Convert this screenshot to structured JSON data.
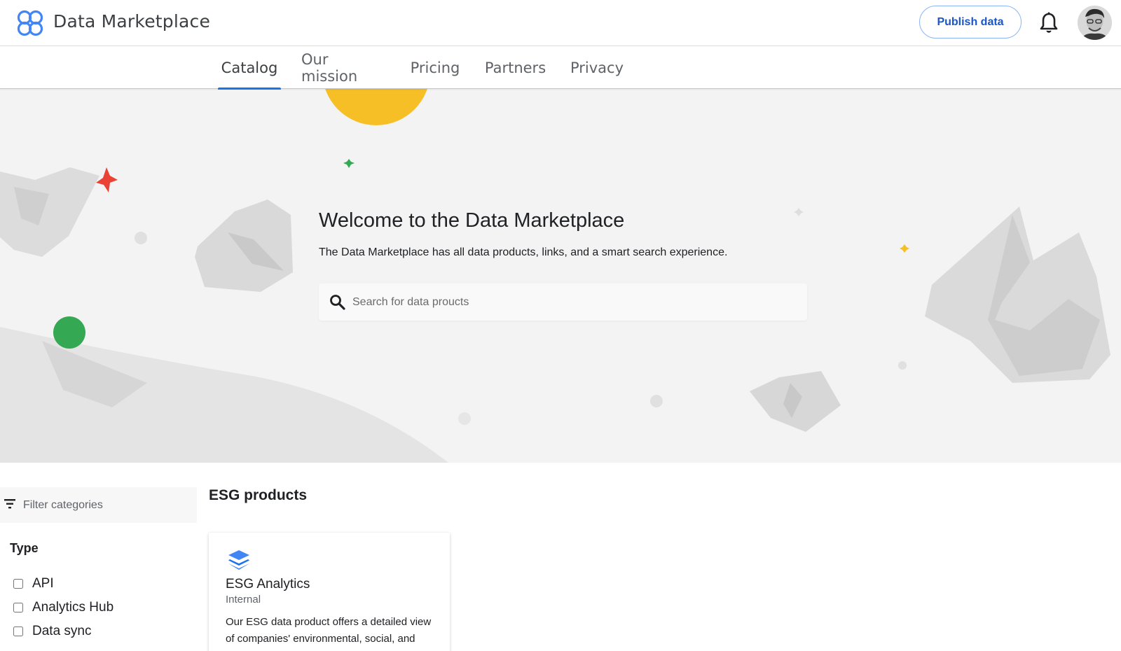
{
  "header": {
    "app_title": "Data Marketplace",
    "publish_label": "Publish data",
    "logo_icon": "clover-logo-icon",
    "notifications_icon": "bell-icon",
    "avatar_icon": "user-avatar"
  },
  "nav": {
    "tabs": [
      {
        "label": "Catalog",
        "active": true
      },
      {
        "label": "Our mission",
        "active": false
      },
      {
        "label": "Pricing",
        "active": false
      },
      {
        "label": "Partners",
        "active": false
      },
      {
        "label": "Privacy",
        "active": false
      }
    ]
  },
  "hero": {
    "title": "Welcome to the Data Marketplace",
    "subtitle": "The Data Marketplace has all data products, links, and a smart search experience.",
    "search_placeholder": "Search for data proucts",
    "search_icon": "search-icon"
  },
  "sidebar": {
    "filter_placeholder": "Filter categories",
    "filter_icon": "filter-icon",
    "type_heading": "Type",
    "type_options": [
      {
        "label": "API",
        "checked": false
      },
      {
        "label": "Analytics Hub",
        "checked": false
      },
      {
        "label": "Data sync",
        "checked": false
      }
    ]
  },
  "main": {
    "section_title": "ESG products",
    "cards": [
      {
        "icon": "data-product-icon",
        "title": "ESG Analytics",
        "subtitle": "Internal",
        "description": "Our ESG data product offers a detailed view of companies' environmental, social, and governance performance."
      }
    ]
  },
  "colors": {
    "accent": "#1a73e8",
    "publish_text": "#1a56c8",
    "hero_bg": "#f3f3f3",
    "yellow_orb": "#f6bf26",
    "green_orb": "#34a853",
    "red_star": "#ea4335"
  }
}
